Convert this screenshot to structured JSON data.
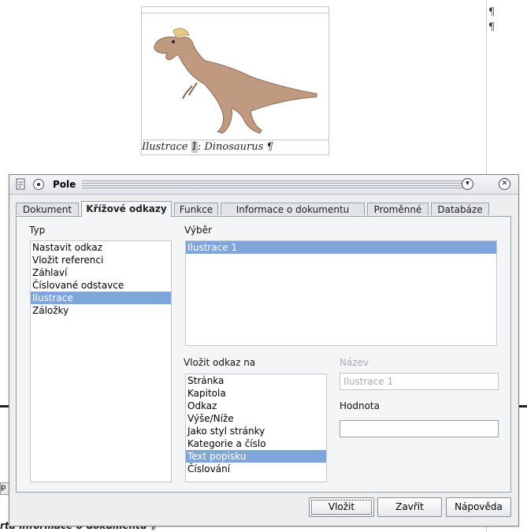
{
  "document": {
    "caption_prefix": "Ilustrace",
    "caption_number": "1",
    "caption_text": ": Dinosaurus",
    "pilcrow": "¶",
    "bottom_text": "rta·informace·o·dokumentu ¶",
    "side_marker": "p"
  },
  "dialog": {
    "title": "Pole",
    "tabs": [
      {
        "label": "Dokument"
      },
      {
        "label": "Křížové odkazy"
      },
      {
        "label": "Funkce"
      },
      {
        "label": "Informace o dokumentu"
      },
      {
        "label": "Proměnné"
      },
      {
        "label": "Databáze"
      }
    ],
    "active_tab": "Křížové odkazy",
    "type": {
      "label": "Typ",
      "items": [
        "Nastavit odkaz",
        "Vložit referenci",
        "Záhlaví",
        "Číslované odstavce",
        "Ilustrace",
        "Záložky"
      ],
      "selected": "Ilustrace"
    },
    "selection": {
      "label": "Výběr",
      "items": [
        "Ilustrace 1"
      ],
      "selected": "Ilustrace 1"
    },
    "insert_ref": {
      "label": "Vložit odkaz na",
      "items": [
        "Stránka",
        "Kapitola",
        "Odkaz",
        "Výše/Níže",
        "Jako styl stránky",
        "Kategorie a číslo",
        "Text popisku",
        "Číslování"
      ],
      "selected": "Text popisku"
    },
    "name": {
      "label": "Název",
      "value": "Ilustrace 1"
    },
    "value": {
      "label": "Hodnota",
      "value": ""
    },
    "buttons": {
      "insert": "Vložit",
      "close": "Zavřít",
      "help": "Nápověda"
    }
  },
  "colors": {
    "selection_bg": "#7ea6dd",
    "dialog_bg": "#eceef0"
  },
  "icons": [
    "app-icon",
    "pin-icon",
    "minimize-icon",
    "close-icon"
  ]
}
